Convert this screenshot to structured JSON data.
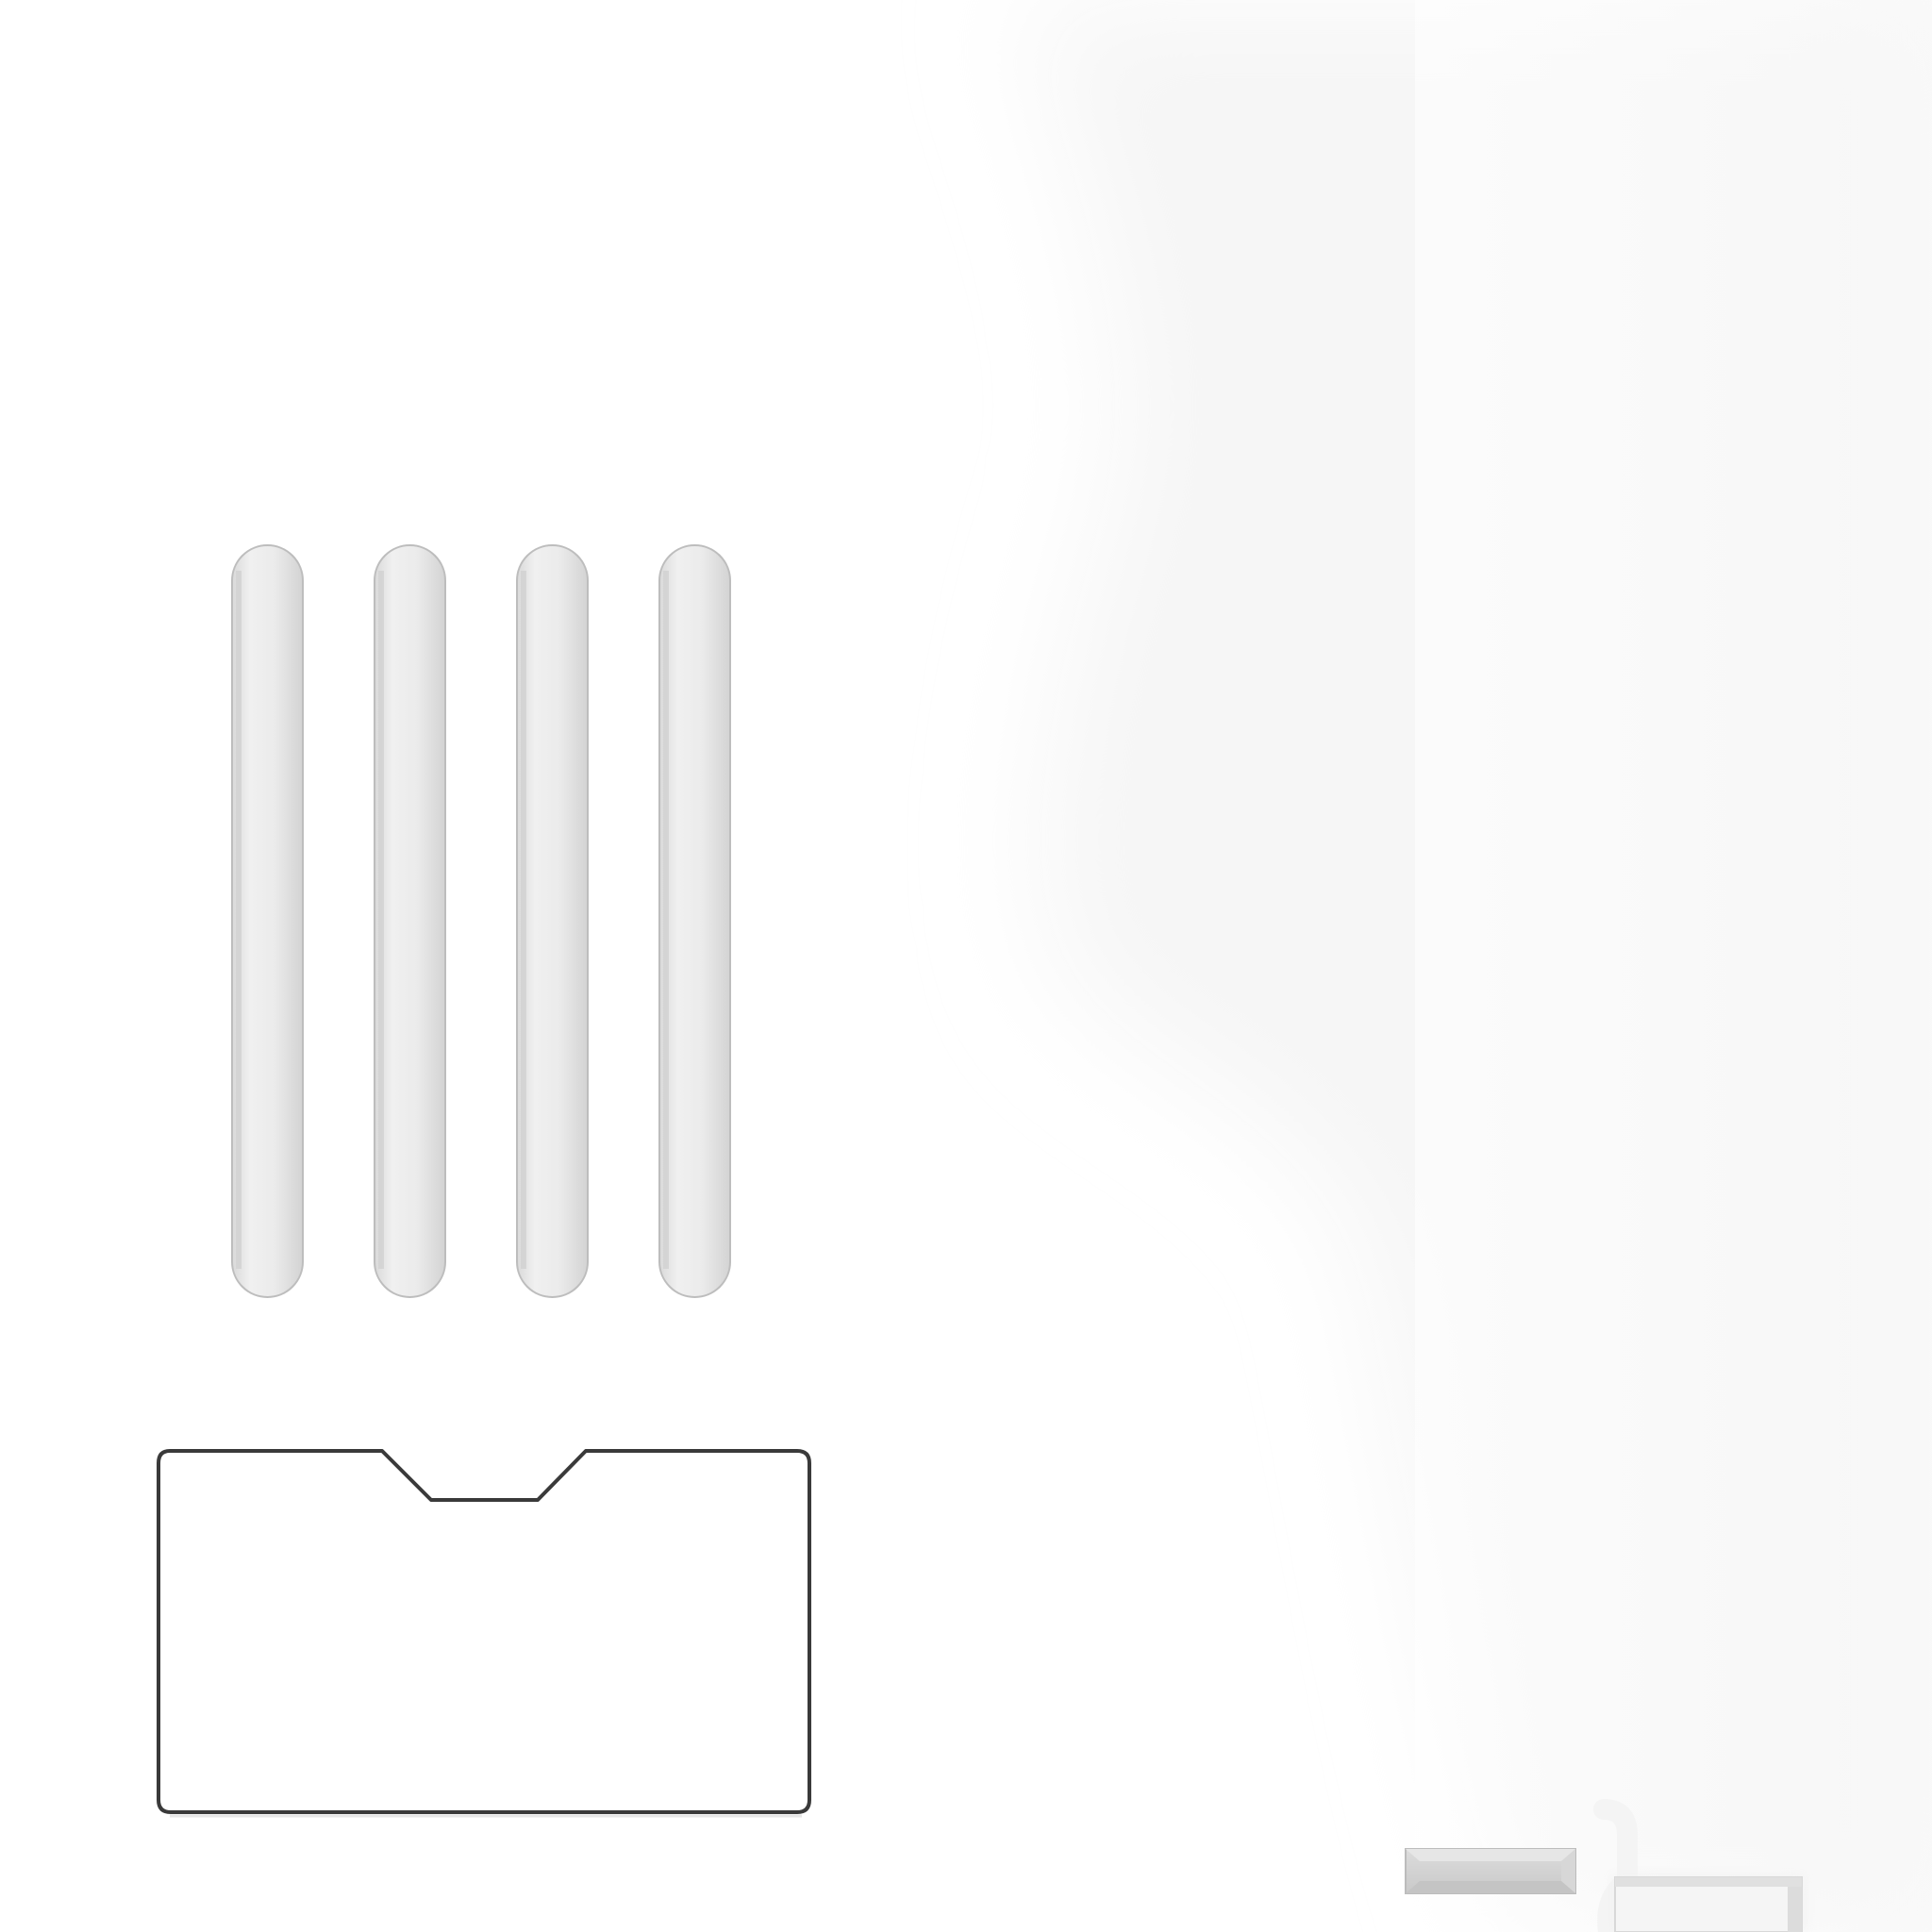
{
  "scene": {
    "background_color": "#ffffff",
    "shadow_color": "#f7f7f7",
    "object_count": 7,
    "objects": [
      {
        "name": "contact-pin",
        "count": 4,
        "fill": "#ececec",
        "stroke": "#bdbdbd"
      },
      {
        "name": "card-slot-outline",
        "count": 1,
        "fill": "#ffffff",
        "stroke": "#3a3a3a"
      },
      {
        "name": "sim-tray-part",
        "count": 1,
        "fill": "#d0d0d0",
        "stroke": "#bcbcbc"
      },
      {
        "name": "usb-port-part",
        "count": 1,
        "fill": "#ececec",
        "stroke": "#c8c8c8"
      }
    ]
  }
}
